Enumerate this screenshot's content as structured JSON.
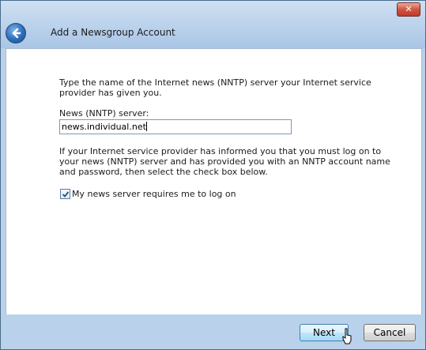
{
  "window": {
    "close_label": "✕"
  },
  "header": {
    "title": "Add a Newsgroup Account"
  },
  "content": {
    "intro": "Type the name of the Internet news (NNTP) server your Internet service provider has given you.",
    "server_label": "News (NNTP) server:",
    "server_value": "news.individual.net",
    "logon_info": "If your Internet service provider has informed you that you must log on to your news (NNTP) server and has provided you with an NNTP account name and password, then select the check box below.",
    "checkbox_label": "My news server requires me to log on",
    "checkbox_checked": true
  },
  "footer": {
    "next_label": "Next",
    "cancel_label": "Cancel"
  },
  "icons": {
    "back": "back-arrow-icon",
    "check": "checkmark-icon",
    "cursor": "mouse-pointer-icon"
  }
}
